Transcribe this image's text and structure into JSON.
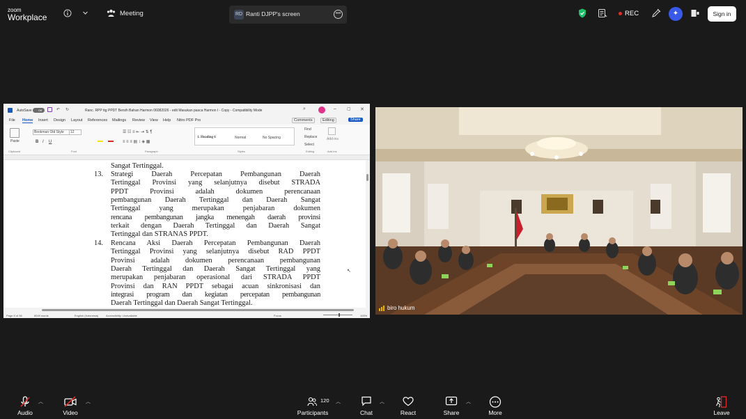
{
  "topbar": {
    "logo_small": "zoom",
    "logo_big": "Workplace",
    "meeting_label": "Meeting",
    "screen_share_initials": "RD",
    "screen_share_label": "Ranti DJPP's screen",
    "rec_label": "REC",
    "signin_label": "Sign in"
  },
  "word": {
    "title": "Ranc. RPP ttg PPDT Bersih Bahan Harmon 06082026 - edit Masukan pasca Harmon I - Copy  -  Compatibility Mode",
    "autosave": "AutoSave",
    "autosave_state": "Off",
    "menu": [
      "File",
      "Home",
      "Insert",
      "Design",
      "Layout",
      "References",
      "Mailings",
      "Review",
      "View",
      "Help",
      "Nitro PDF Pro"
    ],
    "comments_label": "Comments",
    "editing_label": "Editing",
    "share_label": "Share",
    "font_name": "Bookman Old Style",
    "font_size": "12",
    "styles": [
      "1.  Heading 6",
      "Normal",
      "No Spacing"
    ],
    "find_label": "Find",
    "replace_label": "Replace",
    "select_label": "Select",
    "addins_label": "Add-ins",
    "group_labels": [
      "Clipboard",
      "Font",
      "Paragraph",
      "Styles",
      "Editing",
      "Add-ins"
    ],
    "paste_label": "Paste",
    "status": {
      "page": "Page 5 of 36",
      "words": "8549 words",
      "language": "English (Indonesia)",
      "accessibility": "Accessibility: Unavailable",
      "focus": "Focus",
      "zoom": "100%"
    },
    "doc": {
      "top_line": "Sangat Tertinggal.",
      "items": [
        {
          "num": "13.",
          "lines": [
            "Strategi Daerah Percepatan Pembangunan Daerah",
            "Tertinggal Provinsi yang selanjutnya disebut STRADA",
            "PPDT Provinsi adalah dokumen perencanaan",
            "pembangunan Daerah Tertinggal dan Daerah Sangat",
            "Tertinggal yang merupakan penjabaran dokumen",
            "rencana pembangunan jangka menengah daerah provinsi",
            "terkait dengan Daerah Tertinggal dan Daerah Sangat",
            "Tertinggal dan STRANAS PPDT."
          ]
        },
        {
          "num": "14.",
          "lines": [
            "Rencana Aksi Daerah Percepatan Pembangunan Daerah",
            "Tertinggal Provinsi yang selanjutnya disebut RAD PPDT",
            "Provinsi adalah dokumen perencanaan pembangunan",
            "Daerah Tertinggal dan Daerah Sangat Tertinggal yang",
            "merupakan penjabaran operasional dari STRADA PPDT",
            "Provinsi dan RAN PPDT sebagai acuan sinkronisasi dan",
            "integrasi program dan kegiatan percepatan pembangunan",
            "Daerah Tertinggal dan Daerah Sangat Tertinggal."
          ]
        }
      ]
    }
  },
  "camera": {
    "participant_name": "biro hukum"
  },
  "bottombar": {
    "audio_label": "Audio",
    "video_label": "Video",
    "participants_label": "Participants",
    "participants_count": "120",
    "chat_label": "Chat",
    "react_label": "React",
    "share_label": "Share",
    "more_label": "More",
    "leave_label": "Leave"
  },
  "colors": {
    "background": "#1a1a1a",
    "rec": "#e02b2b",
    "ai_button": "#3a59e8",
    "leave": "#e02b2b",
    "shield": "#1fbf6a",
    "word_blue": "#185abd"
  }
}
